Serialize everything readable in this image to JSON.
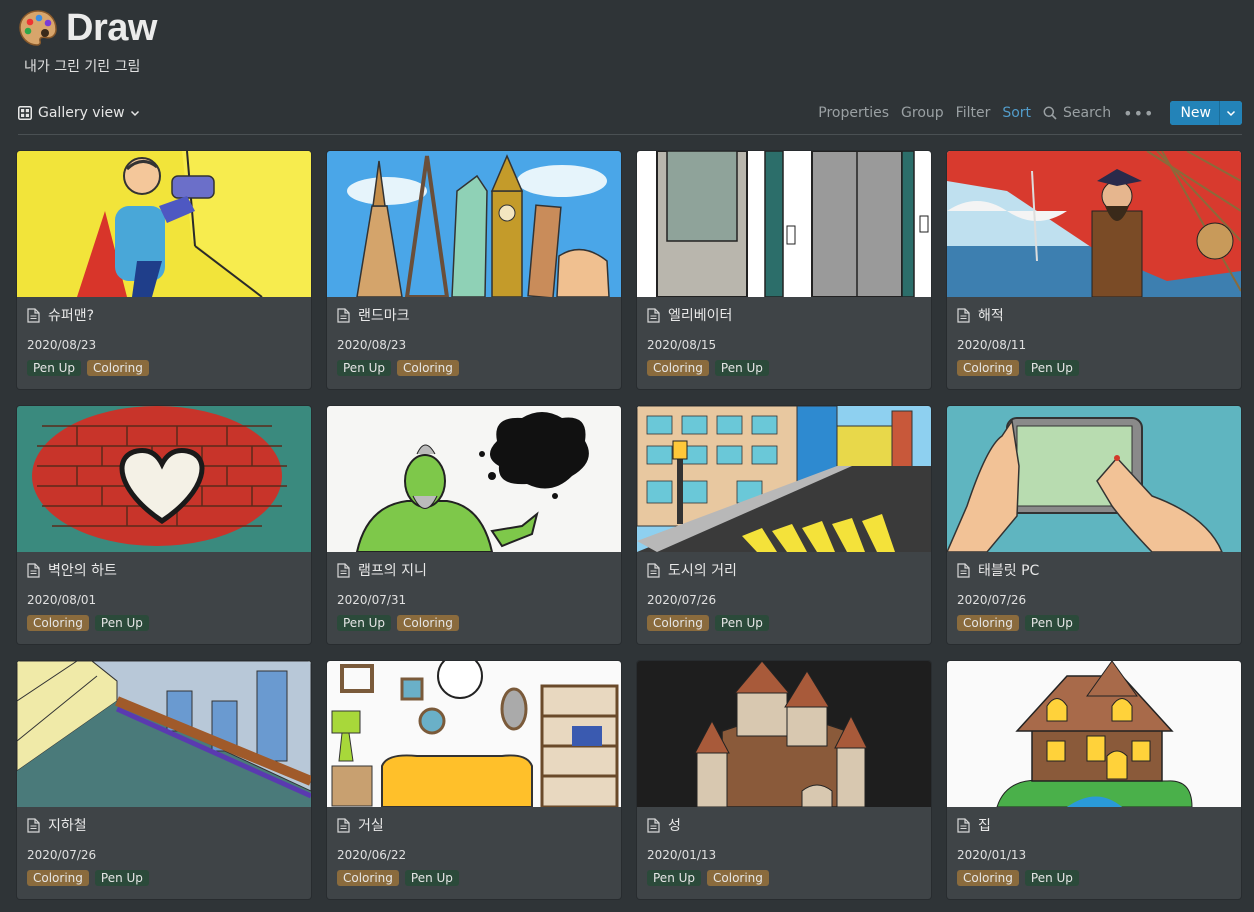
{
  "page": {
    "title": "Draw",
    "subtitle": "내가 그린 기린 그림",
    "emoji_icon": "palette-icon"
  },
  "toolbar": {
    "view_label": "Gallery view",
    "properties": "Properties",
    "group": "Group",
    "filter": "Filter",
    "sort": "Sort",
    "search": "Search",
    "more": "•••",
    "new": "New"
  },
  "colors": {
    "background": "#2f3437",
    "card": "#3f4447",
    "accent": "#2383b8",
    "sort_active": "#529cca",
    "tag_coloring": "#8a6b3d",
    "tag_penup": "#2b4a3a"
  },
  "cards": [
    {
      "title": "슈퍼맨?",
      "date": "2020/08/23",
      "tags": [
        "Pen Up",
        "Coloring"
      ]
    },
    {
      "title": "랜드마크",
      "date": "2020/08/23",
      "tags": [
        "Pen Up",
        "Coloring"
      ]
    },
    {
      "title": "엘리베이터",
      "date": "2020/08/15",
      "tags": [
        "Coloring",
        "Pen Up"
      ]
    },
    {
      "title": "해적",
      "date": "2020/08/11",
      "tags": [
        "Coloring",
        "Pen Up"
      ]
    },
    {
      "title": "벽안의 하트",
      "date": "2020/08/01",
      "tags": [
        "Coloring",
        "Pen Up"
      ]
    },
    {
      "title": "램프의 지니",
      "date": "2020/07/31",
      "tags": [
        "Pen Up",
        "Coloring"
      ]
    },
    {
      "title": "도시의 거리",
      "date": "2020/07/26",
      "tags": [
        "Coloring",
        "Pen Up"
      ]
    },
    {
      "title": "태블릿 PC",
      "date": "2020/07/26",
      "tags": [
        "Coloring",
        "Pen Up"
      ]
    },
    {
      "title": "지하철",
      "date": "2020/07/26",
      "tags": [
        "Coloring",
        "Pen Up"
      ]
    },
    {
      "title": "거실",
      "date": "2020/06/22",
      "tags": [
        "Coloring",
        "Pen Up"
      ]
    },
    {
      "title": "성",
      "date": "2020/01/13",
      "tags": [
        "Pen Up",
        "Coloring"
      ]
    },
    {
      "title": "집",
      "date": "2020/01/13",
      "tags": [
        "Coloring",
        "Pen Up"
      ]
    }
  ]
}
